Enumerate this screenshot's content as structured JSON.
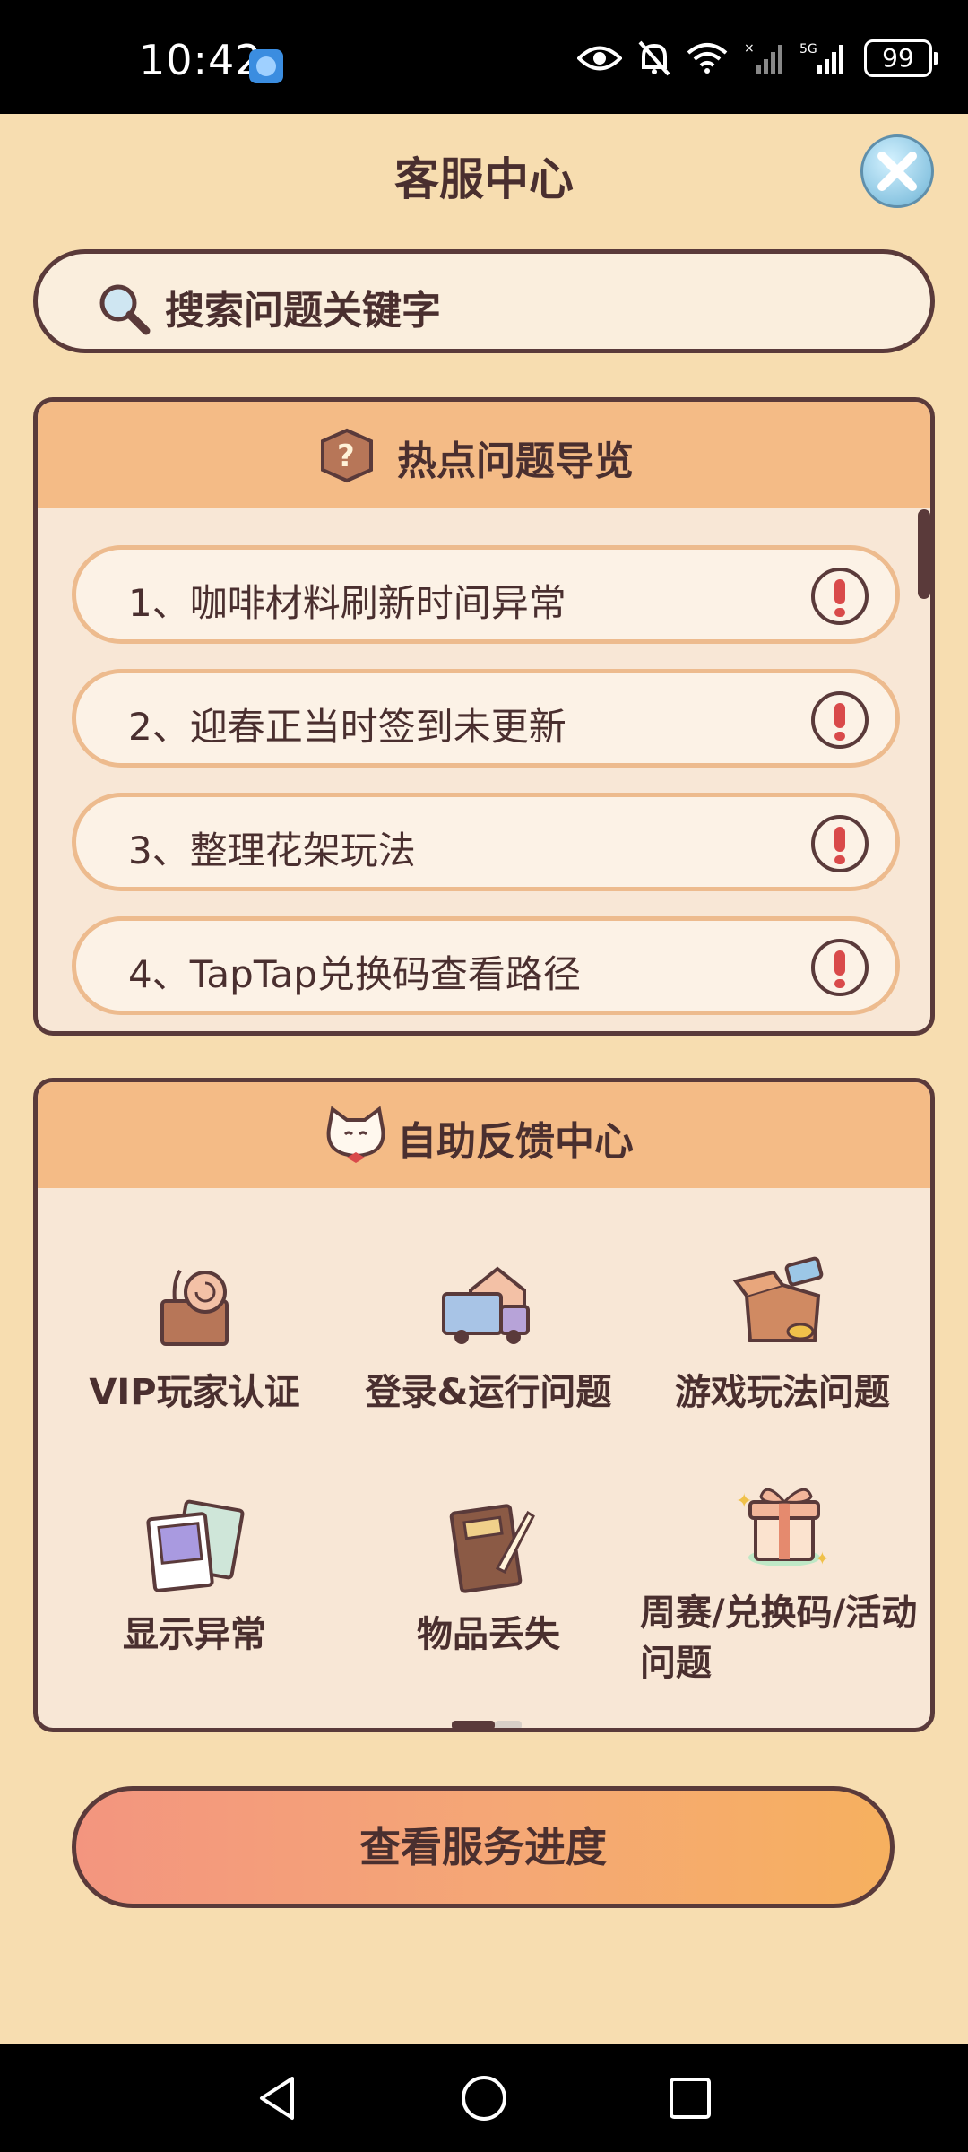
{
  "status_bar": {
    "time": "10:42",
    "battery": "99",
    "network_label": "5G",
    "icons": [
      "app-badge-icon",
      "eye-icon",
      "bell-off-icon",
      "wifi-icon",
      "signal-x-icon",
      "signal-5g-icon",
      "battery-icon"
    ]
  },
  "header": {
    "title": "客服中心",
    "close_icon": "close-icon"
  },
  "search": {
    "placeholder": "搜索问题关键字",
    "icon": "search-icon"
  },
  "faq": {
    "title": "热点问题导览",
    "icon": "question-box-icon",
    "items": [
      {
        "label": "1、咖啡材料刷新时间异常"
      },
      {
        "label": "2、迎春正当时签到未更新"
      },
      {
        "label": "3、整理花架玩法"
      },
      {
        "label": "4、TapTap兑换码查看路径"
      }
    ]
  },
  "feedback": {
    "title": "自助反馈中心",
    "icon": "cat-icon",
    "items": [
      {
        "label": "VIP玩家认证",
        "icon": "snail-box-icon"
      },
      {
        "label": "登录&运行问题",
        "icon": "truck-icon"
      },
      {
        "label": "游戏玩法问题",
        "icon": "open-box-icon"
      },
      {
        "label": "显示异常",
        "icon": "photo-cards-icon"
      },
      {
        "label": "物品丢失",
        "icon": "notebook-icon"
      },
      {
        "label": "周赛/兑换码/活动问题",
        "icon": "gift-icon"
      }
    ]
  },
  "progress_button": {
    "label": "查看服务进度"
  },
  "colors": {
    "background": "#f7ddb0",
    "header_bar": "#f4bb86",
    "border": "#5a3a3a",
    "text": "#4a2f2f",
    "alert": "#d94a4a"
  }
}
